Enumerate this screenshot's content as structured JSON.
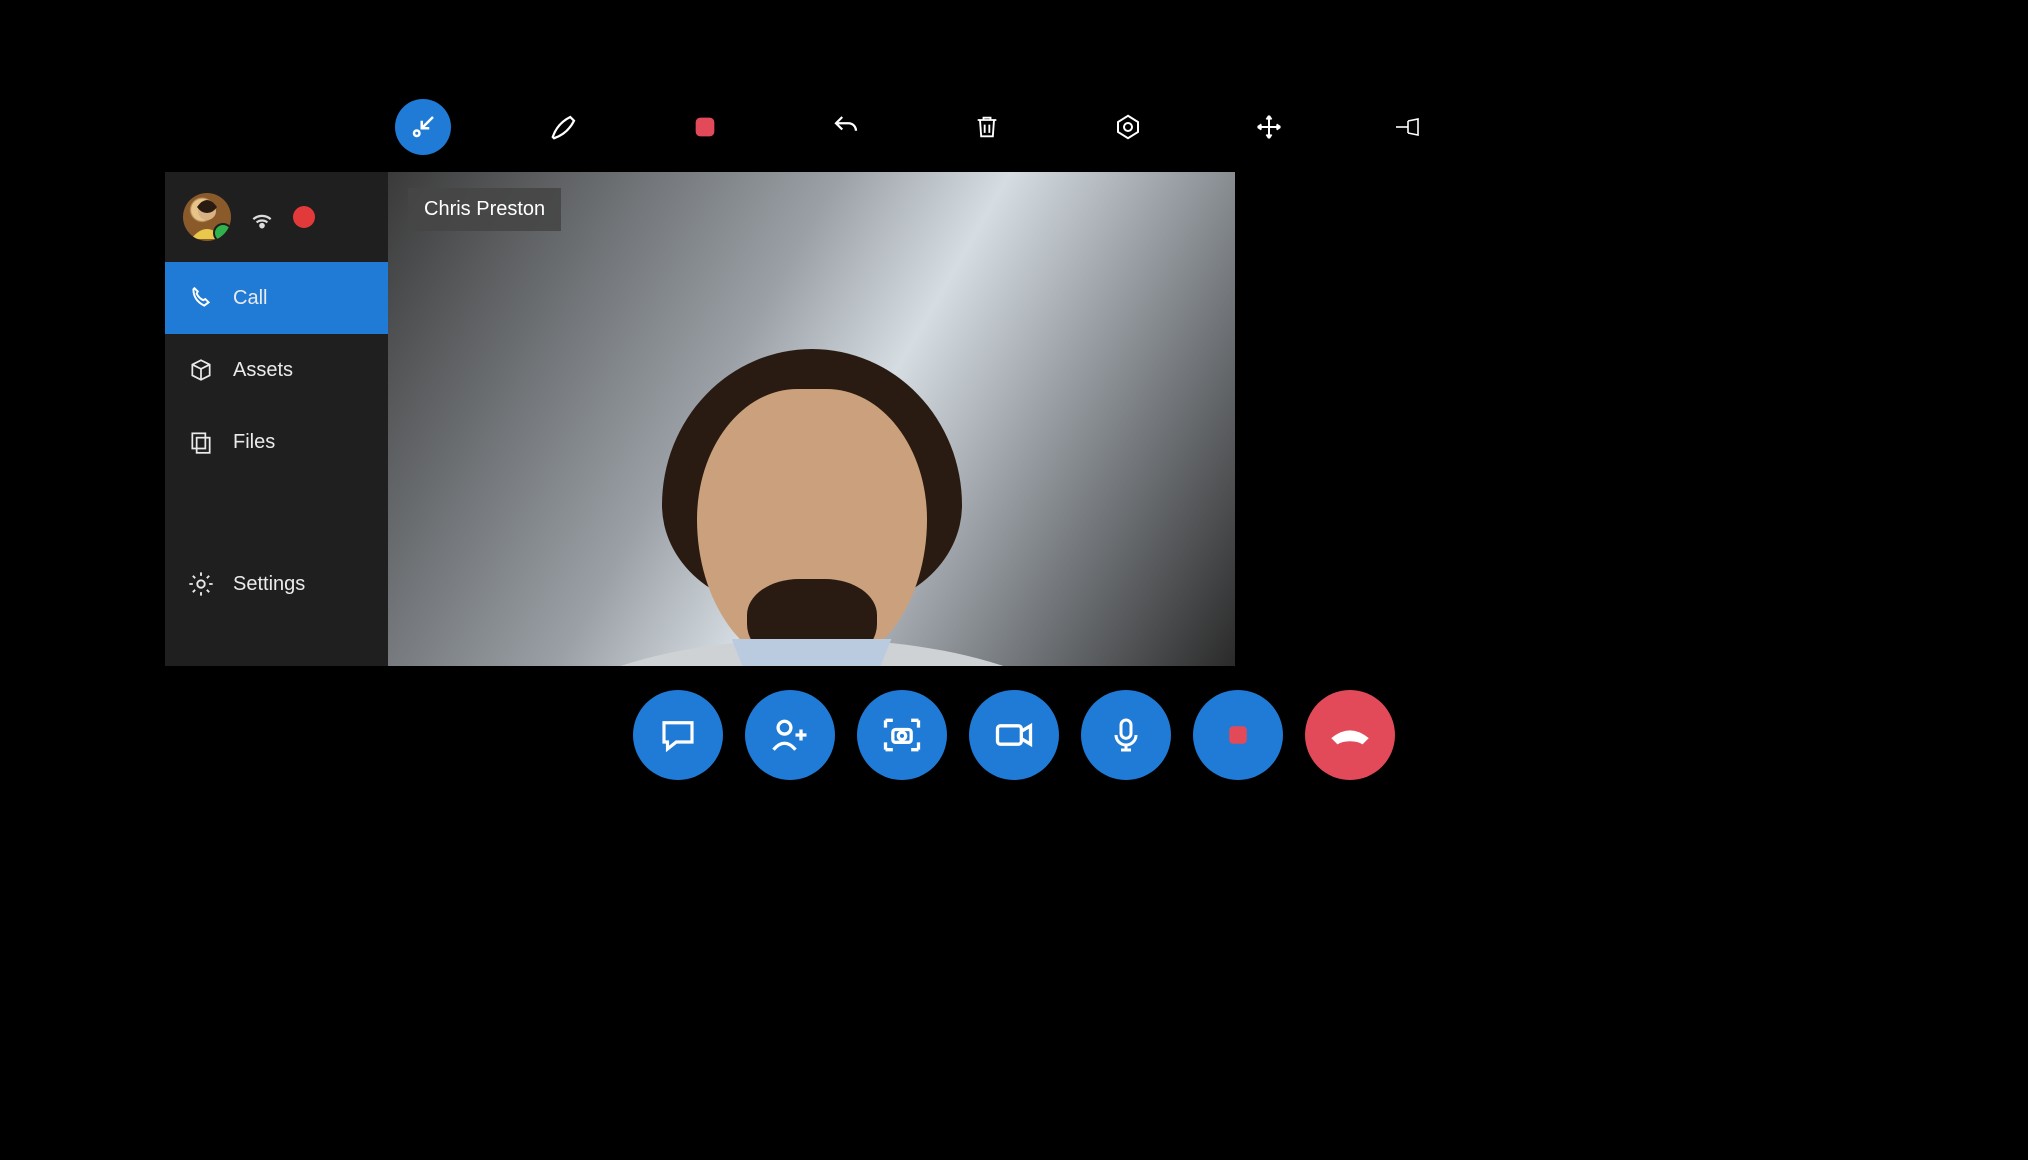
{
  "colors": {
    "accent": "#1f7bd6",
    "danger": "#e24a5a",
    "record": "#e23a3a",
    "background": "#000000"
  },
  "top_toolbar": {
    "items": [
      {
        "name": "minimize-window",
        "icon": "minimize-arrow-icon",
        "active": true
      },
      {
        "name": "annotate-ink",
        "icon": "pen-icon",
        "active": false
      },
      {
        "name": "record",
        "icon": "record-icon",
        "active": false
      },
      {
        "name": "undo",
        "icon": "undo-icon",
        "active": false
      },
      {
        "name": "delete",
        "icon": "trash-icon",
        "active": false
      },
      {
        "name": "focus",
        "icon": "focus-target-icon",
        "active": false
      },
      {
        "name": "move",
        "icon": "move-arrows-icon",
        "active": false
      },
      {
        "name": "pin",
        "icon": "pin-icon",
        "active": false
      }
    ]
  },
  "sidebar": {
    "user": {
      "status_icon": "online-status-icon",
      "recording_active": true
    },
    "items": [
      {
        "icon": "phone-icon",
        "label": "Call",
        "active": true
      },
      {
        "icon": "box-icon",
        "label": "Assets",
        "active": false
      },
      {
        "icon": "files-icon",
        "label": "Files",
        "active": false
      }
    ],
    "bottom_item": {
      "icon": "gear-icon",
      "label": "Settings"
    }
  },
  "call": {
    "remote_participant_name": "Chris Preston"
  },
  "call_bar": {
    "buttons": [
      {
        "name": "chat",
        "icon": "chat-icon"
      },
      {
        "name": "add-participant",
        "icon": "add-person-icon"
      },
      {
        "name": "capture",
        "icon": "camera-capture-icon"
      },
      {
        "name": "video-toggle",
        "icon": "video-icon"
      },
      {
        "name": "mic-toggle",
        "icon": "mic-icon"
      },
      {
        "name": "record-call",
        "icon": "record-square-icon"
      },
      {
        "name": "end-call",
        "icon": "hangup-icon",
        "style": "end"
      }
    ]
  }
}
